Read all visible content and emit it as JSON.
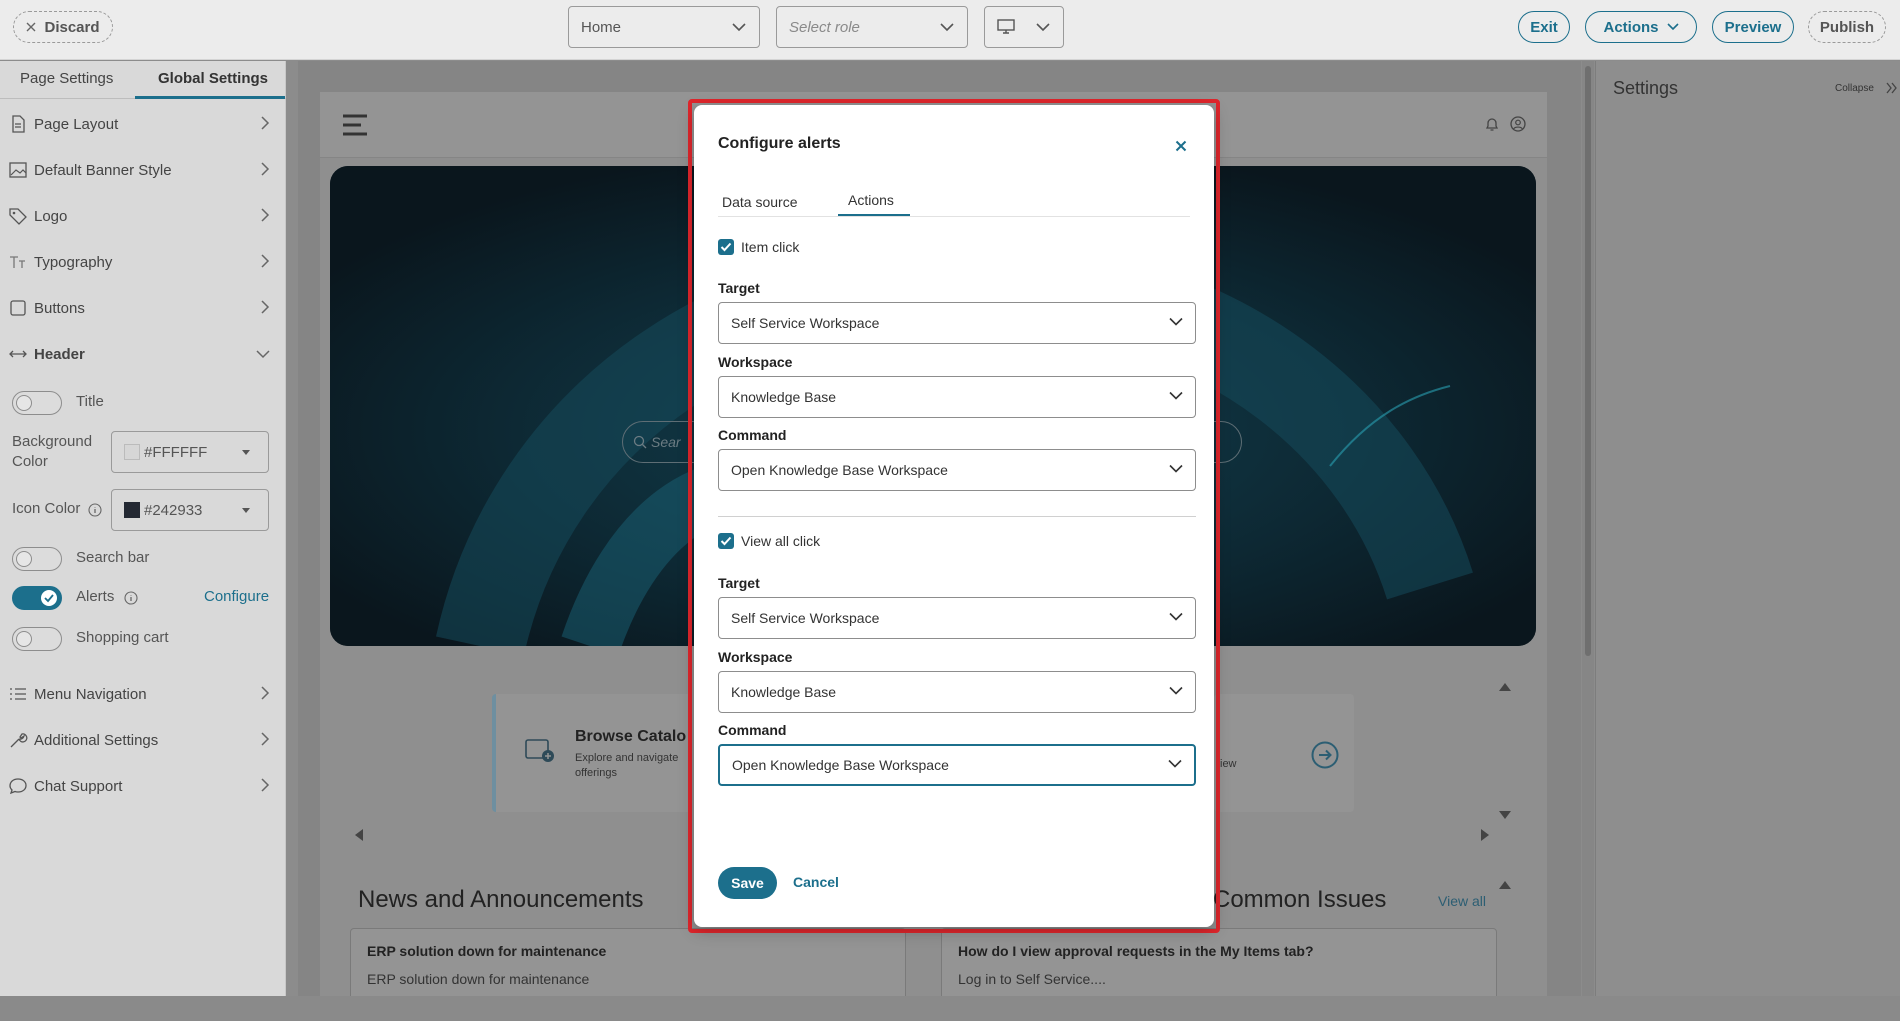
{
  "topbar": {
    "discard_label": "Discard",
    "page_select": "Home",
    "role_placeholder": "Select role",
    "exit_label": "Exit",
    "actions_label": "Actions",
    "preview_label": "Preview",
    "publish_label": "Publish"
  },
  "left_panel": {
    "tabs": [
      {
        "label": "Page Settings",
        "active": false
      },
      {
        "label": "Global Settings",
        "active": true
      }
    ],
    "items": [
      {
        "label": "Page Layout",
        "icon": "page-icon"
      },
      {
        "label": "Default Banner Style",
        "icon": "image-icon"
      },
      {
        "label": "Logo",
        "icon": "tag-icon"
      },
      {
        "label": "Typography",
        "icon": "typography-icon"
      },
      {
        "label": "Buttons",
        "icon": "square-icon"
      },
      {
        "label": "Header",
        "icon": "arrows-horizontal-icon",
        "expanded": true
      }
    ],
    "header_settings": {
      "title_label": "Title",
      "title_on": false,
      "background_color_label": "Background Color",
      "background_color_value": "#FFFFFF",
      "icon_color_label": "Icon Color",
      "icon_color_value": "#242933",
      "search_bar_label": "Search bar",
      "search_bar_on": false,
      "alerts_label": "Alerts",
      "alerts_on": true,
      "configure_label": "Configure",
      "shopping_cart_label": "Shopping cart",
      "shopping_cart_on": false
    },
    "items_after": [
      {
        "label": "Menu Navigation",
        "icon": "list-icon"
      },
      {
        "label": "Additional Settings",
        "icon": "wrench-icon"
      },
      {
        "label": "Chat Support",
        "icon": "chat-icon"
      }
    ]
  },
  "preview": {
    "search_placeholder": "Sear",
    "browse_title": "Browse Catalo",
    "browse_desc_1": "Explore and navigate",
    "browse_desc_2": "offerings",
    "view_text": "iew",
    "news_title": "News and Announcements",
    "issues_title": "Common Issues",
    "view_all": "View all",
    "news_item_title": "ERP solution down for maintenance",
    "news_item_desc": "ERP solution down for maintenance",
    "issue_item_title": "How do I view approval requests in the My Items tab?",
    "issue_item_desc": "Log in to Self Service...."
  },
  "right_panel": {
    "title": "Settings",
    "collapse_label": "Collapse"
  },
  "modal": {
    "title": "Configure alerts",
    "tabs": [
      {
        "label": "Data source",
        "active": false
      },
      {
        "label": "Actions",
        "active": true
      }
    ],
    "item_click": {
      "label": "Item click",
      "checked": true,
      "target_label": "Target",
      "target_value": "Self Service Workspace",
      "workspace_label": "Workspace",
      "workspace_value": "Knowledge Base",
      "command_label": "Command",
      "command_value": "Open Knowledge Base Workspace"
    },
    "view_all_click": {
      "label": "View all click",
      "checked": true,
      "target_label": "Target",
      "target_value": "Self Service Workspace",
      "workspace_label": "Workspace",
      "workspace_value": "Knowledge Base",
      "command_label": "Command",
      "command_value": "Open Knowledge Base Workspace"
    },
    "save_label": "Save",
    "cancel_label": "Cancel"
  },
  "colors": {
    "accent": "#1c6f8c",
    "highlight": "#e0262c",
    "overlay_gray": "#8c8c8c"
  }
}
